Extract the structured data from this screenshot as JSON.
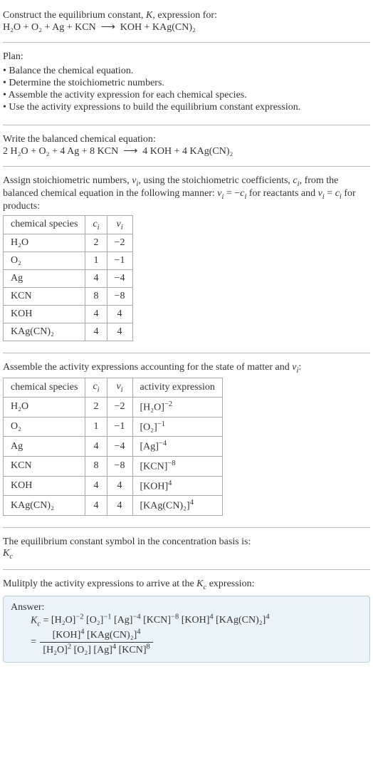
{
  "intro": {
    "line1_a": "Construct the equilibrium constant, ",
    "line1_K": "K",
    "line1_b": ", expression for:",
    "eq_lhs": "H₂O + O₂ + Ag + KCN",
    "arrow": "⟶",
    "eq_rhs": "KOH + KAg(CN)₂"
  },
  "plan": {
    "heading": "Plan:",
    "items": [
      "Balance the chemical equation.",
      "Determine the stoichiometric numbers.",
      "Assemble the activity expression for each chemical species.",
      "Use the activity expressions to build the equilibrium constant expression."
    ]
  },
  "balanced": {
    "heading": "Write the balanced chemical equation:",
    "eq_lhs": "2 H₂O + O₂ + 4 Ag + 8 KCN",
    "arrow": "⟶",
    "eq_rhs": "4 KOH + 4 KAg(CN)₂"
  },
  "stoich": {
    "text_a": "Assign stoichiometric numbers, ",
    "nu_i": "ν",
    "nu_sub": "i",
    "text_b": ", using the stoichiometric coefficients, ",
    "c_i": "c",
    "c_sub": "i",
    "text_c": ", from the balanced chemical equation in the following manner: ",
    "rel_react_a": "ν",
    "rel_react_b": " = −",
    "rel_react_c": "c",
    "text_d": " for reactants and ",
    "rel_prod_a": "ν",
    "rel_prod_b": " = ",
    "rel_prod_c": "c",
    "text_e": " for products:",
    "headers": {
      "species": "chemical species",
      "c": "c",
      "nu": "ν",
      "sub": "i"
    },
    "rows": [
      {
        "sp": "H₂O",
        "c": "2",
        "nu": "−2"
      },
      {
        "sp": "O₂",
        "c": "1",
        "nu": "−1"
      },
      {
        "sp": "Ag",
        "c": "4",
        "nu": "−4"
      },
      {
        "sp": "KCN",
        "c": "8",
        "nu": "−8"
      },
      {
        "sp": "KOH",
        "c": "4",
        "nu": "4"
      },
      {
        "sp": "KAg(CN)₂",
        "c": "4",
        "nu": "4"
      }
    ]
  },
  "activity": {
    "text_a": "Assemble the activity expressions accounting for the state of matter and ",
    "nu": "ν",
    "nu_sub": "i",
    "text_b": ":",
    "headers": {
      "species": "chemical species",
      "c": "c",
      "nu": "ν",
      "sub": "i",
      "act": "activity expression"
    },
    "rows": [
      {
        "sp": "H₂O",
        "c": "2",
        "nu": "−2",
        "base": "[H₂O]",
        "exp": "−2"
      },
      {
        "sp": "O₂",
        "c": "1",
        "nu": "−1",
        "base": "[O₂]",
        "exp": "−1"
      },
      {
        "sp": "Ag",
        "c": "4",
        "nu": "−4",
        "base": "[Ag]",
        "exp": "−4"
      },
      {
        "sp": "KCN",
        "c": "8",
        "nu": "−8",
        "base": "[KCN]",
        "exp": "−8"
      },
      {
        "sp": "KOH",
        "c": "4",
        "nu": "4",
        "base": "[KOH]",
        "exp": "4"
      },
      {
        "sp": "KAg(CN)₂",
        "c": "4",
        "nu": "4",
        "base": "[KAg(CN)₂]",
        "exp": "4"
      }
    ]
  },
  "symbol": {
    "line1": "The equilibrium constant symbol in the concentration basis is:",
    "K": "K",
    "sub": "c"
  },
  "multiply": {
    "text_a": "Mulitply the activity expressions to arrive at the ",
    "K": "K",
    "sub": "c",
    "text_b": " expression:"
  },
  "answer": {
    "label": "Answer:",
    "K": "K",
    "Ksub": "c",
    "eq": " = ",
    "terms": [
      {
        "base": "[H₂O]",
        "exp": "−2"
      },
      {
        "base": "[O₂]",
        "exp": "−1"
      },
      {
        "base": "[Ag]",
        "exp": "−4"
      },
      {
        "base": "[KCN]",
        "exp": "−8"
      },
      {
        "base": "[KOH]",
        "exp": "4"
      },
      {
        "base": "[KAg(CN)₂]",
        "exp": "4"
      }
    ],
    "eq2": "= ",
    "num": [
      {
        "base": "[KOH]",
        "exp": "4"
      },
      {
        "base": "[KAg(CN)₂]",
        "exp": "4"
      }
    ],
    "den": [
      {
        "base": "[H₂O]",
        "exp": "2"
      },
      {
        "base": "[O₂]",
        "exp": ""
      },
      {
        "base": "[Ag]",
        "exp": "4"
      },
      {
        "base": "[KCN]",
        "exp": "8"
      }
    ]
  }
}
